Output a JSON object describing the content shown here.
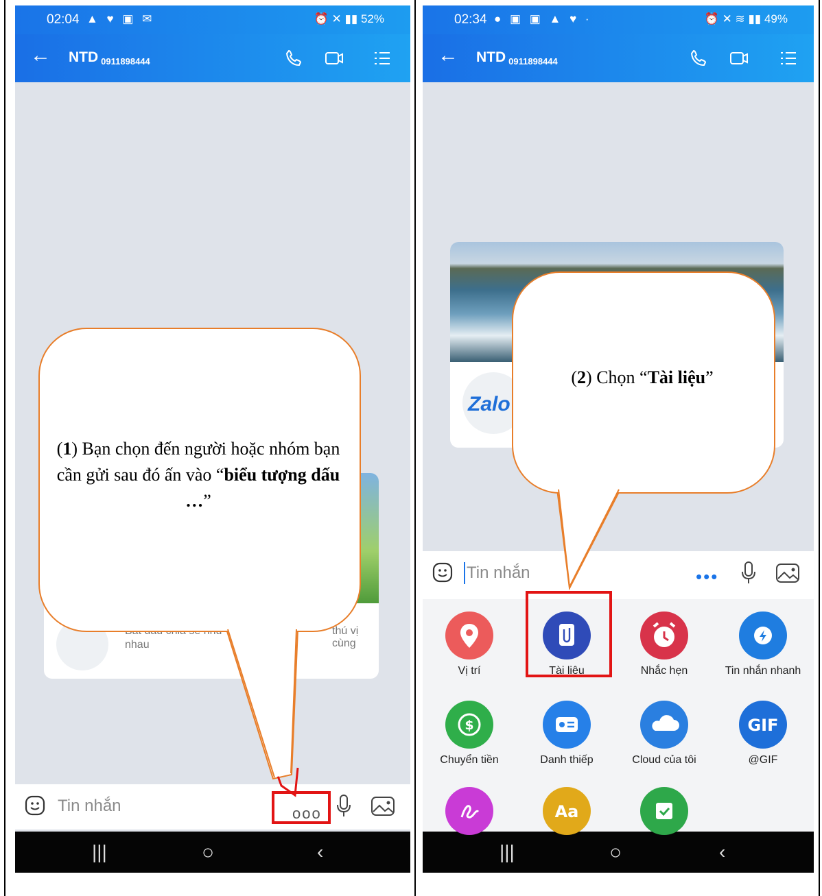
{
  "left_screen": {
    "status": {
      "time": "02:04",
      "battery": "52%"
    },
    "contact": {
      "name": "NTD",
      "phone": "0911898444"
    },
    "card_text_line1": "Bắt đầu chia sẻ như",
    "card_text_line1b": "thú vị cùng",
    "card_text_line2": "nhau",
    "input_placeholder": "Tin nhắn",
    "callout": {
      "step": "1",
      "text_before": ") Bạn chọn đến người hoặc nhóm bạn cần gửi sau đó ấn vào “",
      "bold": "biểu tượng dấu …",
      "text_after": "”"
    }
  },
  "right_screen": {
    "status": {
      "time": "02:34",
      "battery": "49%"
    },
    "contact": {
      "name": "NTD",
      "phone": "0911898444"
    },
    "logo_text": "Zalo",
    "input_placeholder": "Tin nhắn",
    "callout": {
      "step": "2",
      "text_before": ") Chọn “",
      "bold": "Tài liệu",
      "text_after": "”"
    },
    "menu": [
      {
        "label": "Vị trí",
        "color": "#ec5b5b",
        "icon": "location-pin-icon"
      },
      {
        "label": "Tài liệu",
        "color": "#2f4bb8",
        "icon": "paperclip-document-icon"
      },
      {
        "label": "Nhắc hẹn",
        "color": "#d8334a",
        "icon": "alarm-clock-icon"
      },
      {
        "label": "Tin nhắn nhanh",
        "color": "#1f7de0",
        "icon": "lightning-bubble-icon"
      },
      {
        "label": "Chuyển tiền",
        "color": "#2fae4a",
        "icon": "money-transfer-icon"
      },
      {
        "label": "Danh thiếp",
        "color": "#2680e8",
        "icon": "contact-card-icon"
      },
      {
        "label": "Cloud của tôi",
        "color": "#2a7fe0",
        "icon": "cloud-icon"
      },
      {
        "label": "@GIF",
        "color": "#1e6fd9",
        "icon": "gif-icon",
        "glyph": "GIF"
      },
      {
        "label": "",
        "color": "#c93bd6",
        "icon": "signature-icon"
      },
      {
        "label": "",
        "color": "#e1a91a",
        "icon": "text-style-icon",
        "glyph": "Aa"
      },
      {
        "label": "",
        "color": "#2ea84a",
        "icon": "checklist-icon"
      }
    ]
  },
  "colors": {
    "zalo_blue": "#1a74e8",
    "callout_border": "#e87e2a",
    "highlight_red": "#e21414"
  }
}
